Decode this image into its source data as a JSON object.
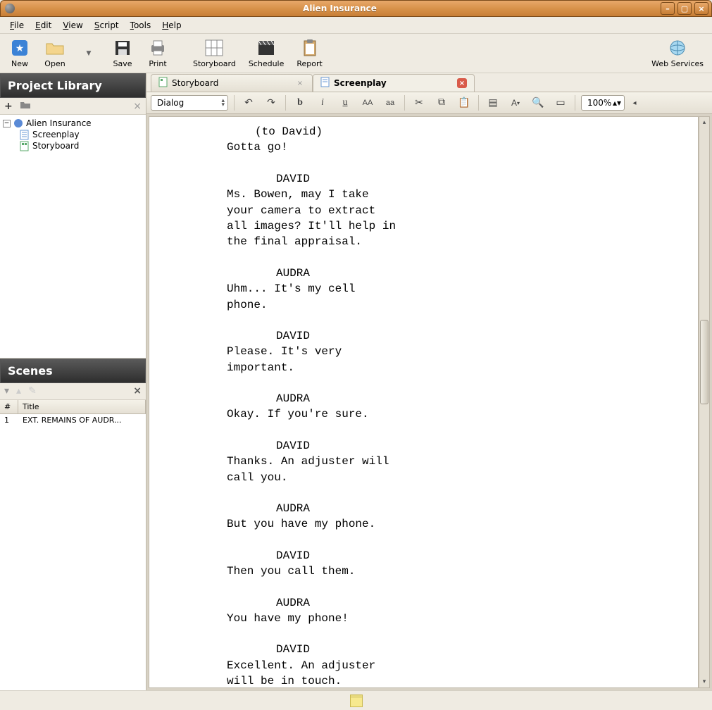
{
  "window": {
    "title": "Alien Insurance"
  },
  "menu": {
    "file": "File",
    "edit": "Edit",
    "view": "View",
    "script": "Script",
    "tools": "Tools",
    "help": "Help"
  },
  "toolbar": {
    "new": "New",
    "open": "Open",
    "save": "Save",
    "print": "Print",
    "storyboard": "Storyboard",
    "schedule": "Schedule",
    "report": "Report",
    "webservices": "Web Services"
  },
  "project_library": {
    "title": "Project Library",
    "root": "Alien Insurance",
    "children": [
      "Screenplay",
      "Storyboard"
    ]
  },
  "scenes": {
    "title": "Scenes",
    "columns": {
      "num": "#",
      "title": "Title"
    },
    "rows": [
      {
        "num": "1",
        "title": "EXT. REMAINS OF AUDR..."
      }
    ]
  },
  "tabs": [
    {
      "label": "Storyboard",
      "active": false
    },
    {
      "label": "Screenplay",
      "active": true
    }
  ],
  "format_combo": "Dialog",
  "zoom": "100%",
  "screenplay": [
    {
      "t": "paren",
      "v": "(to David)"
    },
    {
      "t": "dialog",
      "v": "Gotta go!"
    },
    {
      "t": "blank",
      "v": ""
    },
    {
      "t": "char",
      "v": "DAVID"
    },
    {
      "t": "dialog",
      "v": "Ms. Bowen, may I take"
    },
    {
      "t": "dialog",
      "v": "your camera to extract"
    },
    {
      "t": "dialog",
      "v": "all images? It'll help in"
    },
    {
      "t": "dialog",
      "v": "the final appraisal."
    },
    {
      "t": "blank",
      "v": ""
    },
    {
      "t": "char",
      "v": "AUDRA"
    },
    {
      "t": "dialog",
      "v": "Uhm... It's my cell"
    },
    {
      "t": "dialog",
      "v": "phone."
    },
    {
      "t": "blank",
      "v": ""
    },
    {
      "t": "char",
      "v": "DAVID"
    },
    {
      "t": "dialog",
      "v": "Please. It's very"
    },
    {
      "t": "dialog",
      "v": "important."
    },
    {
      "t": "blank",
      "v": ""
    },
    {
      "t": "char",
      "v": "AUDRA"
    },
    {
      "t": "dialog",
      "v": "Okay. If you're sure."
    },
    {
      "t": "blank",
      "v": ""
    },
    {
      "t": "char",
      "v": "DAVID"
    },
    {
      "t": "dialog",
      "v": "Thanks. An adjuster will"
    },
    {
      "t": "dialog",
      "v": "call you."
    },
    {
      "t": "blank",
      "v": ""
    },
    {
      "t": "char",
      "v": "AUDRA"
    },
    {
      "t": "dialog",
      "v": "But you have my phone."
    },
    {
      "t": "blank",
      "v": ""
    },
    {
      "t": "char",
      "v": "DAVID"
    },
    {
      "t": "dialog",
      "v": "Then you call them."
    },
    {
      "t": "blank",
      "v": ""
    },
    {
      "t": "char",
      "v": "AUDRA"
    },
    {
      "t": "dialog",
      "v": "You have my phone!"
    },
    {
      "t": "blank",
      "v": ""
    },
    {
      "t": "char",
      "v": "DAVID"
    },
    {
      "t": "dialog",
      "v": "Excellent. An adjuster"
    },
    {
      "t": "dialog",
      "v": "will be in touch."
    }
  ]
}
